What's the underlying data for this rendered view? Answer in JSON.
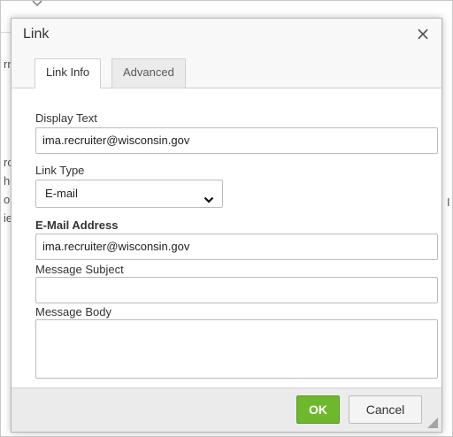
{
  "background": {
    "left_fragments": [
      "rn",
      "ro",
      "he",
      "or",
      "ie"
    ],
    "right_fragment": "I"
  },
  "dialog": {
    "title": "Link",
    "close_glyph": "×",
    "tabs": [
      {
        "label": "Link Info",
        "active": true
      },
      {
        "label": "Advanced",
        "active": false
      }
    ],
    "display_text": {
      "label": "Display Text",
      "value": "ima.recruiter@wisconsin.gov"
    },
    "link_type": {
      "label": "Link Type",
      "selected": "E-mail"
    },
    "email_address": {
      "label": "E-Mail Address",
      "value": "ima.recruiter@wisconsin.gov"
    },
    "message_subject": {
      "label": "Message Subject",
      "value": ""
    },
    "message_body": {
      "label": "Message Body",
      "value": ""
    },
    "buttons": {
      "ok": "OK",
      "cancel": "Cancel"
    }
  },
  "colors": {
    "ok_button": "#6eb82e",
    "title_bar": "#f8f8f8",
    "footer": "#ebebeb"
  }
}
